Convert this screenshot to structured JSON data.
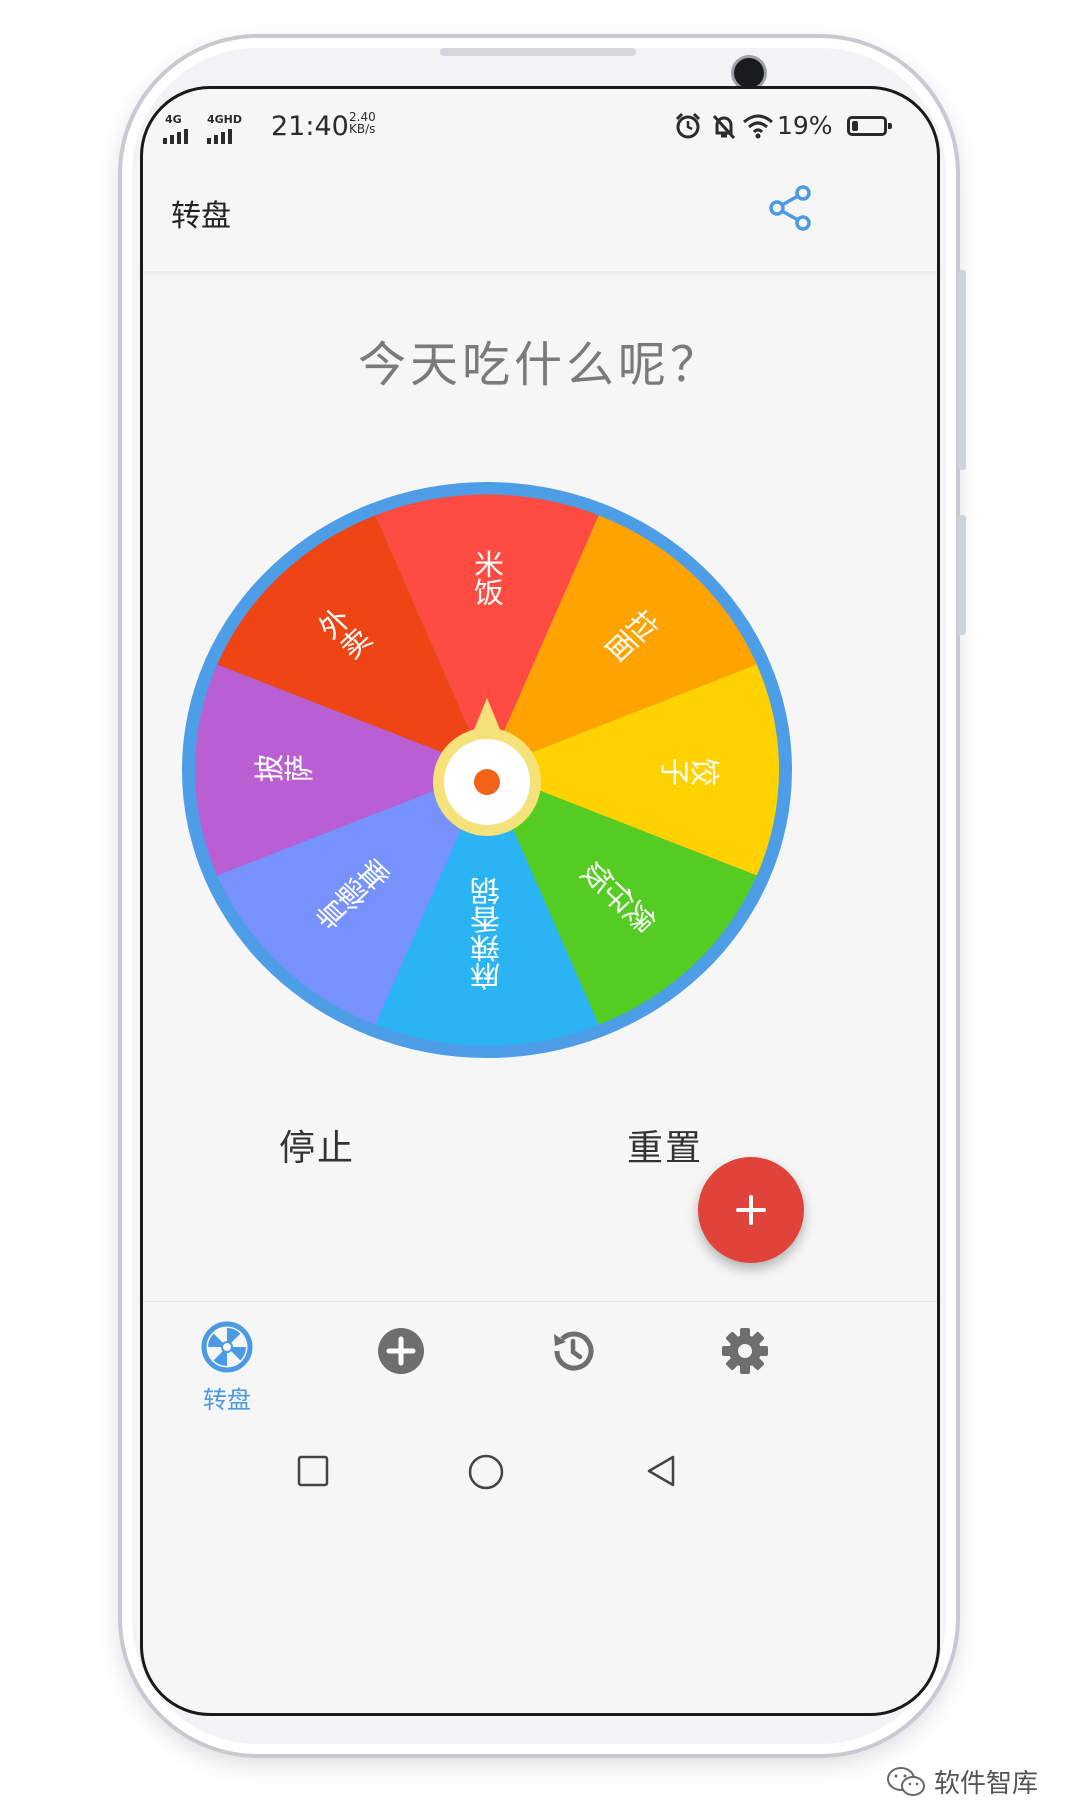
{
  "status_bar": {
    "network_1": "4G",
    "network_2": "4GHD",
    "time": "21:40",
    "speed_value": "2.40",
    "speed_unit": "KB/s",
    "battery_percent": "19%",
    "battery_level": 0.19
  },
  "app_bar": {
    "title": "转盘",
    "share_icon": "share-icon"
  },
  "main": {
    "question": "今天吃什么呢？",
    "wheel": {
      "segments": [
        {
          "label": "米饭",
          "color": "#ff4c43"
        },
        {
          "label": "拉面",
          "color": "#ffa300"
        },
        {
          "label": "饺子",
          "color": "#ffd200"
        },
        {
          "label": "煲仔饭",
          "color": "#55cc22"
        },
        {
          "label": "麻辣香锅",
          "color": "#2bb4f4"
        },
        {
          "label": "肯德基",
          "color": "#7792fc"
        },
        {
          "label": "披萨",
          "color": "#ba5ed4"
        },
        {
          "label": "外卖",
          "color": "#ef4515"
        }
      ],
      "rim_color": "#4d9de7",
      "hub_color": "#f5e27a",
      "center_dot_color": "#f26318"
    },
    "stop_label": "停止",
    "reset_label": "重置",
    "fab_icon": "plus-icon",
    "fab_color": "#e0433a"
  },
  "bottom_nav": {
    "items": [
      {
        "icon": "wheel-icon",
        "label": "转盘",
        "active": true
      },
      {
        "icon": "add-circle-icon",
        "label": "",
        "active": false
      },
      {
        "icon": "history-icon",
        "label": "",
        "active": false
      },
      {
        "icon": "gear-icon",
        "label": "",
        "active": false
      }
    ],
    "active_color": "#4a9ae4",
    "inactive_color": "#6e6e6e"
  },
  "system_nav": {
    "square": "recent-apps-icon",
    "circle": "home-icon",
    "triangle": "back-icon"
  },
  "watermark": {
    "text": "软件智库"
  }
}
